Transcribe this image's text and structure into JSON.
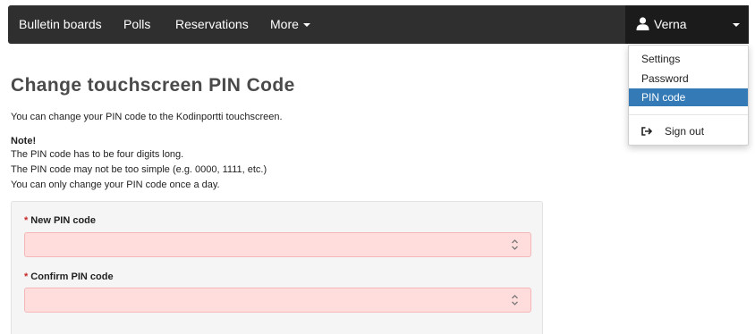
{
  "nav": {
    "items": [
      "Bulletin boards",
      "Polls",
      "Reservations",
      "More"
    ],
    "user": "Verna"
  },
  "user_menu": {
    "items": [
      "Settings",
      "Password",
      "PIN code"
    ],
    "active": "PIN code",
    "sign_out": "Sign out"
  },
  "page": {
    "title": "Change touchscreen PIN Code",
    "intro": "You can change your PIN code to the Kodinportti touchscreen.",
    "note_heading": "Note!",
    "notes": [
      "The PIN code has to be four digits long.",
      "The PIN code may not be too simple (e.g. 0000, 1111, etc.)",
      "You can only change your PIN code once a day."
    ]
  },
  "form": {
    "required_marker": "*",
    "new_pin_label": "New PIN code",
    "confirm_pin_label": "Confirm PIN code"
  },
  "colors": {
    "navbar": "#2f2f2f",
    "active_menu_item": "#337ab7",
    "field_error_bg": "#ffdddd",
    "required": "#c62828"
  }
}
